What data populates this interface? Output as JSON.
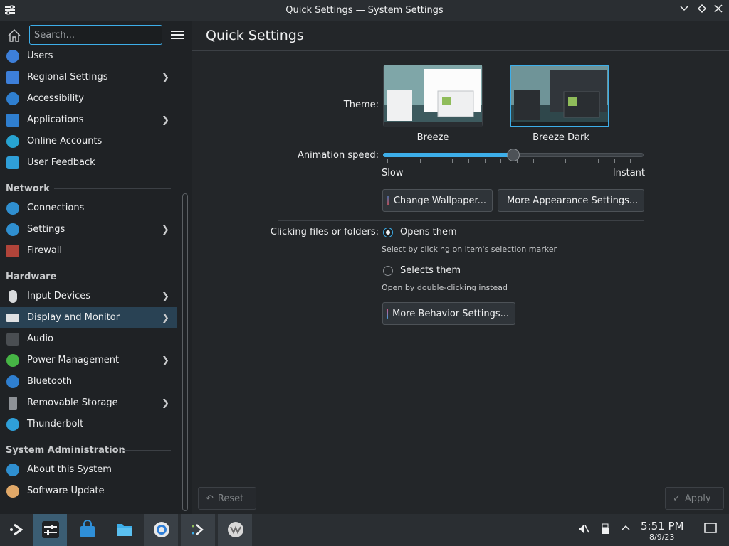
{
  "window": {
    "title": "Quick Settings — System Settings"
  },
  "sidebar": {
    "search_placeholder": "Search...",
    "top_items": [
      {
        "label": "Users",
        "icon": "users-icon",
        "chevron": false
      },
      {
        "label": "Regional Settings",
        "icon": "regional-icon",
        "chevron": true
      },
      {
        "label": "Accessibility",
        "icon": "accessibility-icon",
        "chevron": false
      },
      {
        "label": "Applications",
        "icon": "applications-icon",
        "chevron": true
      },
      {
        "label": "Online Accounts",
        "icon": "online-accounts-icon",
        "chevron": false
      },
      {
        "label": "User Feedback",
        "icon": "feedback-icon",
        "chevron": false
      }
    ],
    "sections": {
      "network": "Network",
      "hardware": "Hardware",
      "system_admin": "System Administration"
    },
    "network_items": [
      {
        "label": "Connections",
        "icon": "globe-icon",
        "chevron": false
      },
      {
        "label": "Settings",
        "icon": "globe-icon",
        "chevron": true
      },
      {
        "label": "Firewall",
        "icon": "firewall-icon",
        "chevron": false
      }
    ],
    "hardware_items": [
      {
        "label": "Input Devices",
        "icon": "mouse-icon",
        "chevron": true
      },
      {
        "label": "Display and Monitor",
        "icon": "monitor-icon",
        "chevron": true,
        "selected": true
      },
      {
        "label": "Audio",
        "icon": "speaker-icon",
        "chevron": false
      },
      {
        "label": "Power Management",
        "icon": "power-icon",
        "chevron": true
      },
      {
        "label": "Bluetooth",
        "icon": "bluetooth-icon",
        "chevron": false
      },
      {
        "label": "Removable Storage",
        "icon": "usb-icon",
        "chevron": true
      },
      {
        "label": "Thunderbolt",
        "icon": "thunderbolt-icon",
        "chevron": false
      }
    ],
    "admin_items": [
      {
        "label": "About this System",
        "icon": "info-icon",
        "chevron": false
      },
      {
        "label": "Software Update",
        "icon": "update-icon",
        "chevron": false
      }
    ]
  },
  "main": {
    "title": "Quick Settings",
    "theme_label": "Theme:",
    "themes": [
      {
        "name": "Breeze",
        "selected": false
      },
      {
        "name": "Breeze Dark",
        "selected": true
      }
    ],
    "animation_label": "Animation speed:",
    "animation_min": "Slow",
    "animation_max": "Instant",
    "animation_value": 0.5,
    "change_wallpaper": "Change Wallpaper...",
    "more_appearance": "More Appearance Settings...",
    "clicking_label": "Clicking files or folders:",
    "opens_them": "Opens them",
    "opens_hint": "Select by clicking on item's selection marker",
    "selects_them": "Selects them",
    "selects_hint": "Open by double-clicking instead",
    "more_behavior": "More Behavior Settings...",
    "reset": "Reset",
    "apply": "Apply"
  },
  "taskbar": {
    "time": "5:51 PM",
    "date": "8/9/23"
  },
  "colors": {
    "accent": "#3daee9",
    "selection": "#294254"
  }
}
